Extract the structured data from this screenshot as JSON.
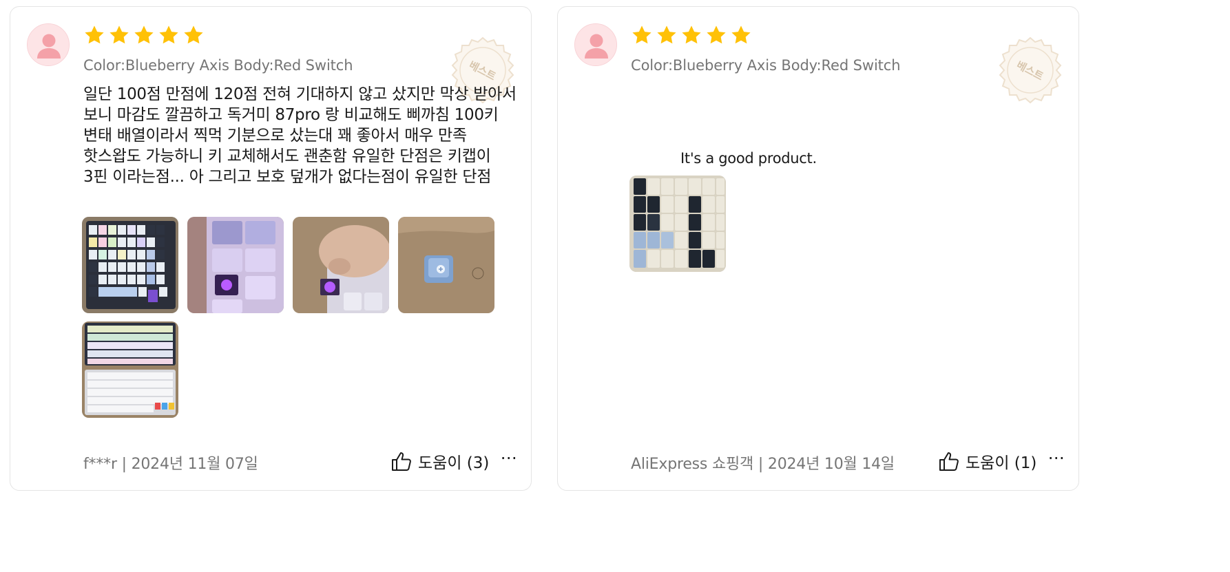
{
  "reviews": [
    {
      "rating": 5,
      "sku": "Color:Blueberry Axis Body:Red Switch",
      "badge": "베스트",
      "text": "일단 100점 만점에 120점 전혀 기대하지 않고 샀지만 막상 받아서 보니 마감도 깔끔하고 독거미 87pro 랑 비교해도 삐까침 100키 변태 배열이라서 찍먹 기분으로 샀는대 꽤 좋아서 매우 만족 핫스왑도 가능하니 키 교체해서도 괜춘함 유일한 단점은 키캡이 3핀 이라는점... 아 그리고 보호 덮개가 없다는점이 유일한 단점",
      "photo_count": 5,
      "author_date": "f***r | 2024년 11월 07일",
      "helpful": "도움이 (3)",
      "more": "⋯"
    },
    {
      "rating": 5,
      "sku": "Color:Blueberry Axis Body:Red Switch",
      "badge": "베스트",
      "text": "It's a good product.",
      "photo_count": 1,
      "author_date": "AliExpress 쇼핑객 | 2024년 10월 14일",
      "helpful": "도움이 (1)",
      "more": "⋯"
    }
  ],
  "colors": {
    "star": "#FFC107",
    "meta_text": "#757575",
    "body_text": "#191919",
    "avatar_bg": "#FDE4E6",
    "avatar_figure": "#F4A1A8",
    "badge": "#E8D9C4"
  },
  "icons": {
    "avatar": "user-silhouette-icon",
    "star": "star-icon",
    "badge": "best-seal-icon",
    "helpful": "thumbs-up-icon",
    "more": "ellipsis-icon"
  }
}
